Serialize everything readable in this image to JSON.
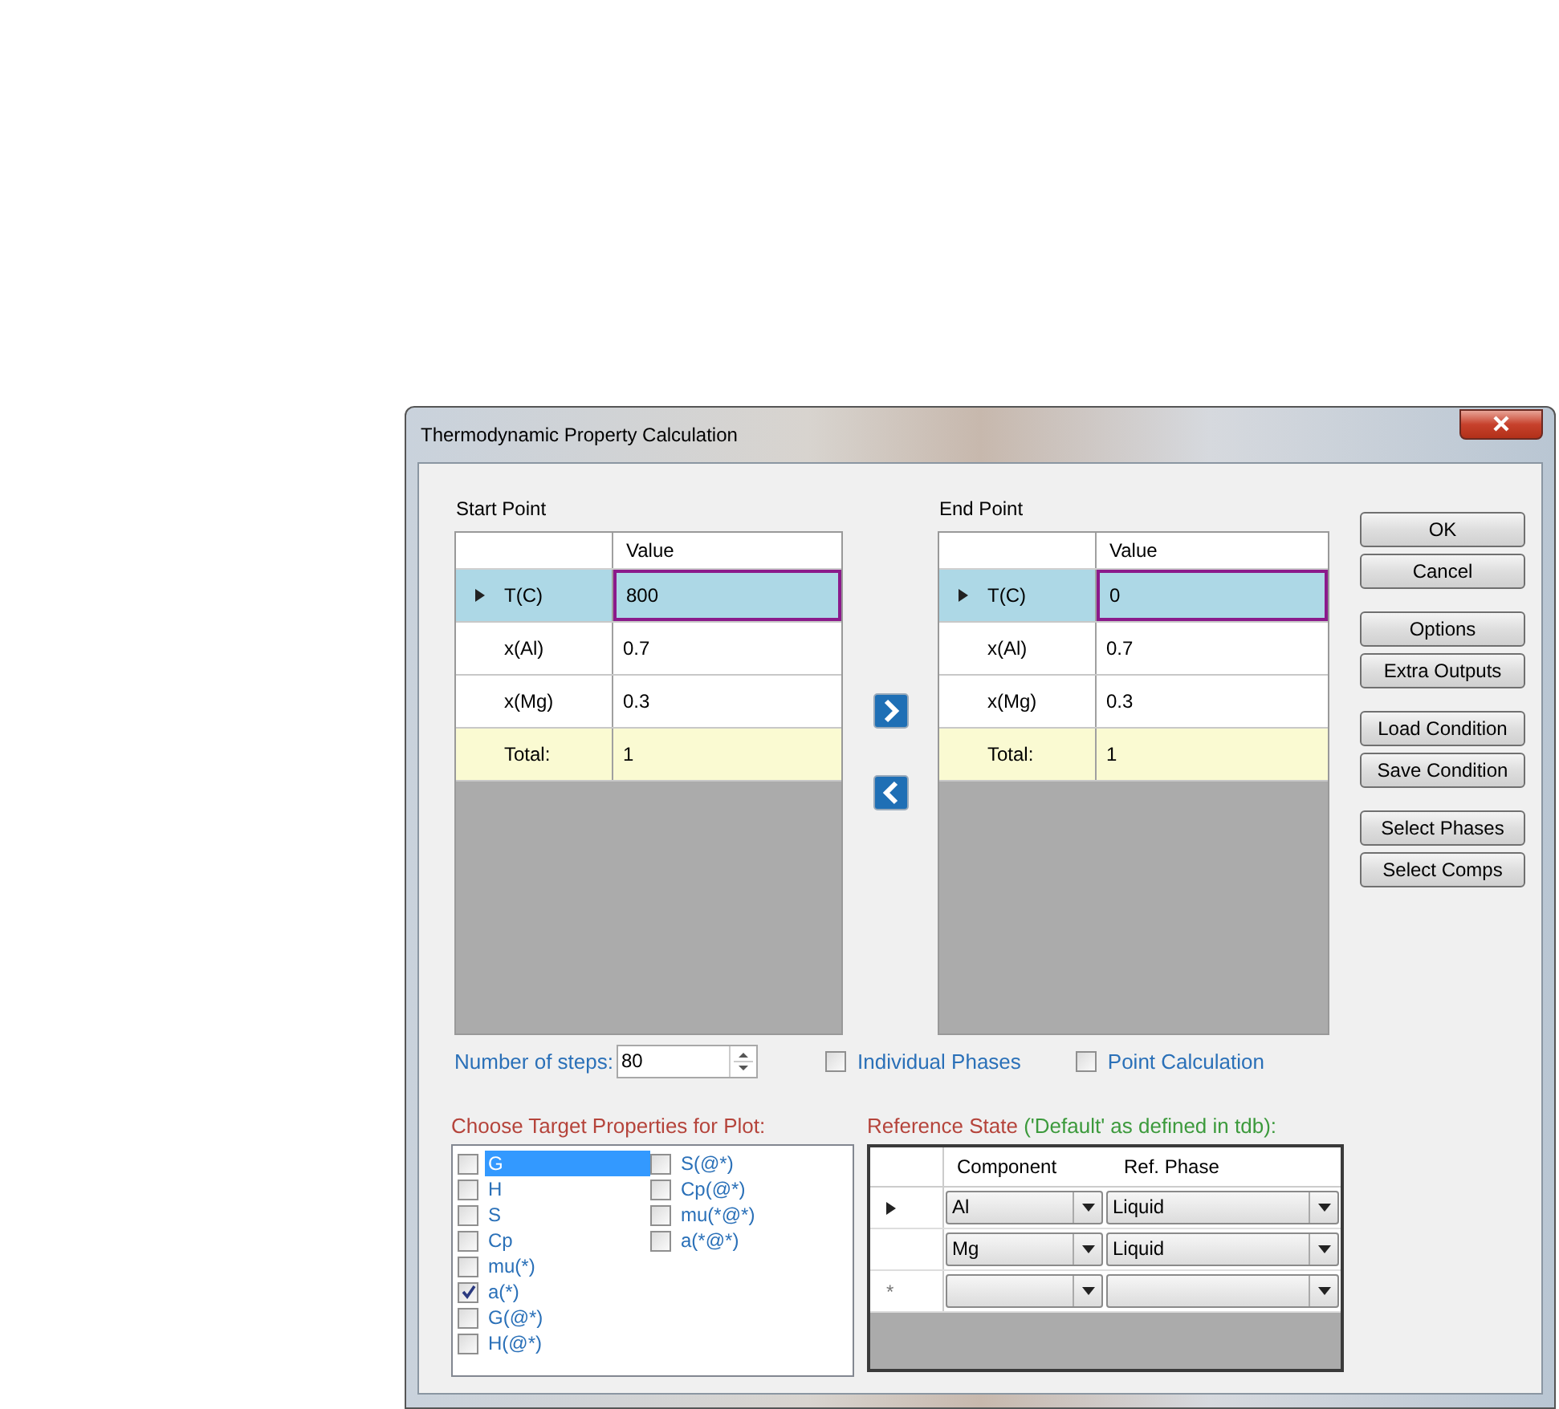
{
  "window": {
    "title": "Thermodynamic Property Calculation"
  },
  "start_point": {
    "label": "Start Point",
    "value_header": "Value",
    "rows": [
      {
        "label": "T(C)",
        "value": "800",
        "kind": "normal",
        "selected": true
      },
      {
        "label": "x(Al)",
        "value": "0.7",
        "kind": "normal",
        "selected": false
      },
      {
        "label": "x(Mg)",
        "value": "0.3",
        "kind": "normal",
        "selected": false
      },
      {
        "label": "Total:",
        "value": "1",
        "kind": "total",
        "selected": false
      }
    ]
  },
  "end_point": {
    "label": "End Point",
    "value_header": "Value",
    "rows": [
      {
        "label": "T(C)",
        "value": "0",
        "kind": "normal",
        "selected": true
      },
      {
        "label": "x(Al)",
        "value": "0.7",
        "kind": "normal",
        "selected": false
      },
      {
        "label": "x(Mg)",
        "value": "0.3",
        "kind": "normal",
        "selected": false
      },
      {
        "label": "Total:",
        "value": "1",
        "kind": "total",
        "selected": false
      }
    ]
  },
  "button_groups": [
    [
      "OK",
      "Cancel"
    ],
    [
      "Options",
      "Extra Outputs"
    ],
    [
      "Load Condition",
      "Save Condition"
    ],
    [
      "Select Phases",
      "Select Comps"
    ]
  ],
  "steps": {
    "label": "Number of steps:",
    "value": "80"
  },
  "options": [
    {
      "label": "Individual Phases",
      "checked": false
    },
    {
      "label": "Point Calculation",
      "checked": false
    }
  ],
  "target_properties": {
    "title": "Choose Target Properties for Plot:",
    "items": [
      {
        "label": "G",
        "checked": false,
        "selected": true
      },
      {
        "label": "H",
        "checked": false,
        "selected": false
      },
      {
        "label": "S",
        "checked": false,
        "selected": false
      },
      {
        "label": "Cp",
        "checked": false,
        "selected": false
      },
      {
        "label": "mu(*)",
        "checked": false,
        "selected": false
      },
      {
        "label": "a(*)",
        "checked": true,
        "selected": false
      },
      {
        "label": "G(@*)",
        "checked": false,
        "selected": false
      },
      {
        "label": "H(@*)",
        "checked": false,
        "selected": false
      },
      {
        "label": "S(@*)",
        "checked": false,
        "selected": false
      },
      {
        "label": "Cp(@*)",
        "checked": false,
        "selected": false
      },
      {
        "label": "mu(*@*)",
        "checked": false,
        "selected": false
      },
      {
        "label": "a(*@*)",
        "checked": false,
        "selected": false
      }
    ]
  },
  "reference_state": {
    "title": "Reference State ",
    "note": "('Default' as defined in tdb):",
    "columns": [
      "Component",
      "Ref. Phase"
    ],
    "rows": [
      {
        "kind": "data",
        "current": true,
        "component": "Al",
        "phase": "Liquid"
      },
      {
        "kind": "data",
        "current": false,
        "component": "Mg",
        "phase": "Liquid"
      },
      {
        "kind": "new",
        "current": false,
        "marker": "*"
      }
    ]
  }
}
